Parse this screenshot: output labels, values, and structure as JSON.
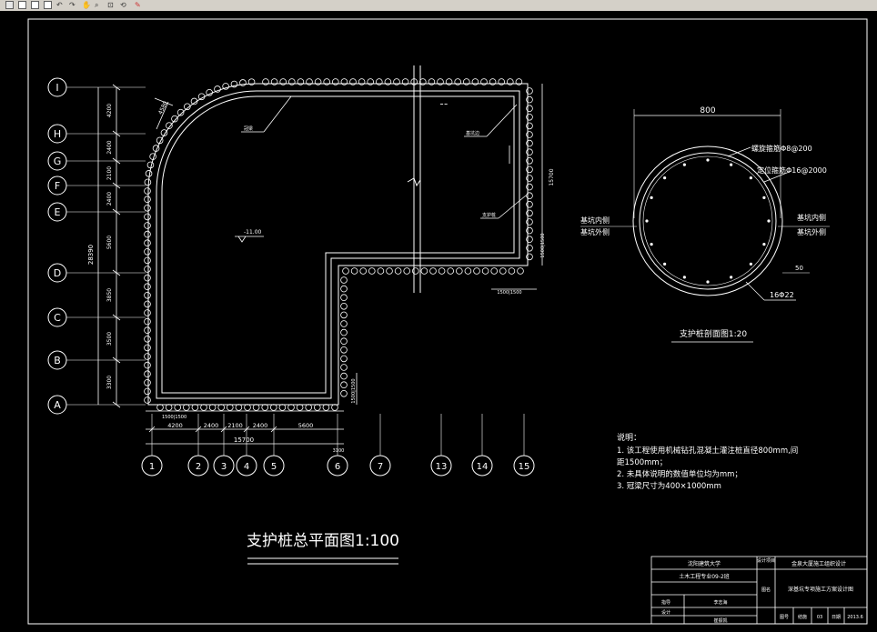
{
  "toolbar": {
    "icons": [
      "new-icon",
      "open-icon",
      "save-icon",
      "undo-icon",
      "redo-icon",
      "plot-icon"
    ]
  },
  "plan": {
    "grid_rows": [
      "I",
      "H",
      "G",
      "F",
      "E",
      "D",
      "C",
      "B",
      "A"
    ],
    "grid_cols": [
      "1",
      "2",
      "3",
      "4",
      "5",
      "6",
      "7",
      "13",
      "14",
      "15"
    ],
    "left_dims_total": "28390",
    "left_dims": [
      "4200",
      "2400",
      "2100",
      "2400",
      "5600",
      "3850",
      "3500",
      "3300"
    ],
    "bottom_dims": [
      "4200",
      "2400",
      "2100",
      "2400",
      "5600"
    ],
    "bottom_total": "15700",
    "bottom_extra": "3100",
    "right_dim_total": "15700",
    "right_dims": [
      "1500",
      "1500"
    ],
    "lower_right_dims": [
      "1500",
      "1500"
    ],
    "lower_right_vert": "1500|1500",
    "small_left_label": "1500|1500",
    "corner_label": "4580",
    "elev_label": "-11.00",
    "leader_labels": [
      "冠梁",
      "基坑边",
      "支护桩"
    ],
    "title": "支护桩总平面图1:100"
  },
  "section": {
    "width_label": "800",
    "label_spiral": "螺旋箍筋Φ8@200",
    "label_ring": "定位箍筋Φ16@2000",
    "left_inner": "基坑内侧",
    "left_outer": "基坑外侧",
    "right_inner": "基坑内侧",
    "right_outer": "基坑外侧",
    "cover": "50",
    "main_bars": "16Φ22",
    "title": "支护桩剖面图1:20"
  },
  "notes": {
    "heading": "说明：",
    "lines": [
      "1. 该工程使用机械钻孔混凝土灌注桩直径800mm,间",
      "距1500mm；",
      "2. 未具体说明的数值单位均为mm；",
      "3. 冠梁尺寸为400×1000mm"
    ]
  },
  "titleblock": {
    "school": "沈阳建筑大学",
    "class": "土木工程专业09-2班",
    "project_label": "设计项目",
    "project": "金泉大厦施工组织设计",
    "drawing_label": "图名",
    "drawing": "深基坑专项施工方案设计图",
    "r3c1": "指导",
    "r3c2": "李志海",
    "r4c1": "设计",
    "r4c2": "崔振凯",
    "r5c1": "图号",
    "r5c2": "结施",
    "r5c3": "03",
    "r5c4": "日期",
    "r5c5": "2013.6"
  }
}
